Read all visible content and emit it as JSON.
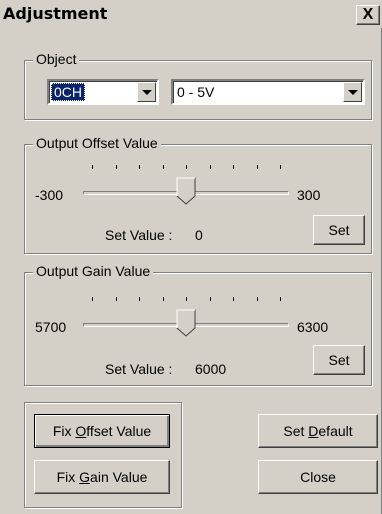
{
  "window": {
    "title": "Adjustment",
    "close_glyph": "X"
  },
  "object": {
    "legend": "Object",
    "channel": "0CH",
    "range": "0 - 5V"
  },
  "offset": {
    "legend": "Output Offset Value",
    "min_label": "-300",
    "max_label": "300",
    "slider_value": 0,
    "set_value_label": "Set Value :",
    "set_value": "0",
    "set_button": "Set"
  },
  "gain": {
    "legend": "Output Gain Value",
    "min_label": "5700",
    "max_label": "6300",
    "slider_value": 6000,
    "set_value_label": "Set Value :",
    "set_value": "6000",
    "set_button": "Set"
  },
  "buttons": {
    "fix_offset_pre": "Fix ",
    "fix_offset_key": "O",
    "fix_offset_post": "ffset Value",
    "fix_gain_pre": "Fix ",
    "fix_gain_key": "G",
    "fix_gain_post": "ain Value",
    "set_default_pre": "Set ",
    "set_default_key": "D",
    "set_default_post": "efault",
    "close": "Close"
  }
}
